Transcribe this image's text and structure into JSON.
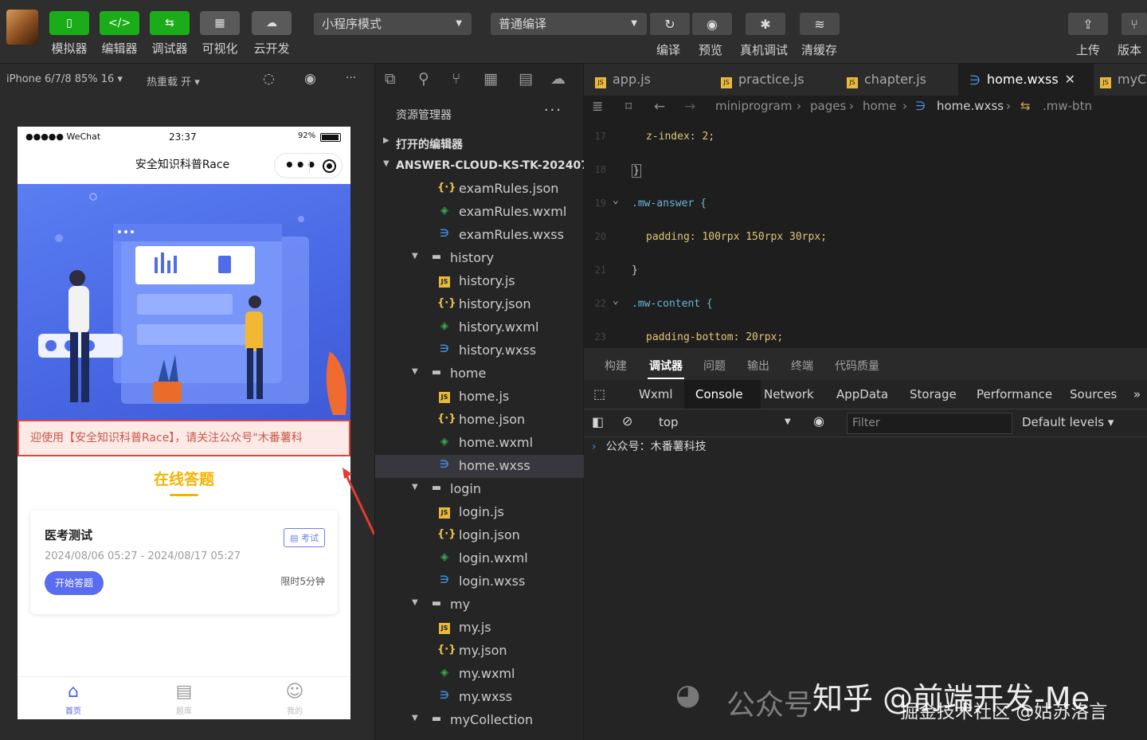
{
  "toolbar": {
    "buttons": [
      {
        "label": "模拟器",
        "glyph": "▯"
      },
      {
        "label": "编辑器",
        "glyph": "</>"
      },
      {
        "label": "调试器",
        "glyph": "⇆"
      },
      {
        "label": "可视化",
        "glyph": "▦"
      },
      {
        "label": "云开发",
        "glyph": "☁"
      }
    ],
    "mode_select": "小程序模式",
    "compile_select": "普通编译",
    "actions": [
      {
        "label": "编译",
        "glyph": "↻"
      },
      {
        "label": "预览",
        "glyph": "◉"
      },
      {
        "label": "真机调试",
        "glyph": "✱"
      },
      {
        "label": "清缓存",
        "glyph": "≋"
      }
    ],
    "right_actions": [
      {
        "label": "上传",
        "glyph": "⇪"
      },
      {
        "label": "版本",
        "glyph": "⑂"
      }
    ]
  },
  "simulator": {
    "device": "iPhone 6/7/8 85% 16 ▾",
    "hot_reload": "热重载 开 ▾",
    "status": {
      "carrier": "●●●●● WeChat",
      "time": "23:37",
      "battery": "92%"
    },
    "nav_title": "安全知识科普Race",
    "notice": "迎使用【安全知识科普Race】，请关注公众号\"木番薯科",
    "section_title": "在线答题",
    "exam": {
      "title": "医考测试",
      "date": "2024/08/06 05:27 - 2024/08/17 05:27",
      "tag": "▤ 考试",
      "limit": "限时5分钟",
      "start_button": "开始答题"
    },
    "tabbar": [
      {
        "label": "首页",
        "glyph": "⌂"
      },
      {
        "label": "题库",
        "glyph": "▤"
      },
      {
        "label": "我的",
        "glyph": "☺"
      }
    ]
  },
  "explorer": {
    "title": "资源管理器",
    "more": "···",
    "open_editors": "打开的编辑器",
    "project": "ANSWER-CLOUD-KS-TK-20240727",
    "tree": [
      {
        "name": "examRules.json",
        "type": "json"
      },
      {
        "name": "examRules.wxml",
        "type": "wxml"
      },
      {
        "name": "examRules.wxss",
        "type": "wxss"
      },
      {
        "name": "history",
        "type": "folder"
      },
      {
        "name": "history.js",
        "type": "js"
      },
      {
        "name": "history.json",
        "type": "json"
      },
      {
        "name": "history.wxml",
        "type": "wxml"
      },
      {
        "name": "history.wxss",
        "type": "wxss"
      },
      {
        "name": "home",
        "type": "folder"
      },
      {
        "name": "home.js",
        "type": "js"
      },
      {
        "name": "home.json",
        "type": "json"
      },
      {
        "name": "home.wxml",
        "type": "wxml"
      },
      {
        "name": "home.wxss",
        "type": "wxss",
        "selected": true
      },
      {
        "name": "login",
        "type": "folder"
      },
      {
        "name": "login.js",
        "type": "js"
      },
      {
        "name": "login.json",
        "type": "json"
      },
      {
        "name": "login.wxml",
        "type": "wxml"
      },
      {
        "name": "login.wxss",
        "type": "wxss"
      },
      {
        "name": "my",
        "type": "folder"
      },
      {
        "name": "my.js",
        "type": "js"
      },
      {
        "name": "my.json",
        "type": "json"
      },
      {
        "name": "my.wxml",
        "type": "wxml"
      },
      {
        "name": "my.wxss",
        "type": "wxss"
      },
      {
        "name": "myCollection",
        "type": "folder"
      }
    ]
  },
  "editor": {
    "tabs": [
      {
        "label": "app.js",
        "type": "js"
      },
      {
        "label": "practice.js",
        "type": "js"
      },
      {
        "label": "chapter.js",
        "type": "js"
      },
      {
        "label": "home.wxss",
        "type": "wxss",
        "active": true
      },
      {
        "label": "myC",
        "type": "js"
      }
    ],
    "close": "✕",
    "breadcrumbs": [
      "miniprogram",
      "pages",
      "home",
      "home.wxss",
      ".mw-btn"
    ],
    "lines": [
      {
        "n": "17",
        "text": "z-index: 2;"
      },
      {
        "n": "18",
        "text": "}"
      },
      {
        "n": "19",
        "text": ".mw-answer {"
      },
      {
        "n": "20",
        "text": "padding: 100rpx 150rpx 30rpx;"
      },
      {
        "n": "21",
        "text": "}"
      },
      {
        "n": "22",
        "text": ".mw-content {"
      },
      {
        "n": "23",
        "text": "padding-bottom: 20rpx;"
      }
    ]
  },
  "devtools": {
    "top_tabs": [
      "构建",
      "调试器",
      "问题",
      "输出",
      "终端",
      "代码质量"
    ],
    "panel_tabs": [
      "Wxml",
      "Console",
      "Network",
      "AppData",
      "Storage",
      "Performance",
      "Sources"
    ],
    "more": "»",
    "context": "top",
    "filter_placeholder": "Filter",
    "levels": "Default levels ▾",
    "console_output": "公众号：木番薯科技"
  },
  "watermark": {
    "line1": "公众号",
    "line2": "知乎 @前端开发-Me",
    "line3": "掘金技术社区 @姑苏洛言"
  },
  "colors": {
    "accent_green": "#1aad19",
    "tab_active": "#4a64e8",
    "exam_yellow": "#f3b400",
    "notice_red": "#e2443b"
  }
}
